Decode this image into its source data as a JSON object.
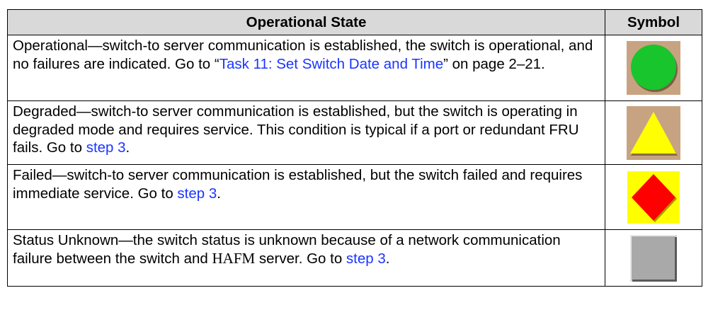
{
  "header": {
    "col_state": "Operational State",
    "col_symbol": "Symbol"
  },
  "rows": [
    {
      "text_before": "Operational—switch-to server communication is established, the switch is operational, and no failures are indicated. Go to “",
      "link": "Task 11: Set Switch Date and Time",
      "text_after": "” on page 2–21.",
      "symbol_icon": "green-circle-icon",
      "symbol_bg": "#c8a382",
      "symbol_color": "#18c52c"
    },
    {
      "text_before": "Degraded—switch-to server communication is established, but the switch is operating in degraded mode and requires service. This condition is typical if a port or redundant FRU fails. Go to ",
      "link": "step 3",
      "text_after": ".",
      "symbol_icon": "yellow-triangle-icon",
      "symbol_bg": "#c8a382",
      "symbol_color": "#ffff00"
    },
    {
      "text_before": "Failed—switch-to server communication is established, but the switch failed and requires immediate service. Go to ",
      "link": "step 3",
      "text_after": ".",
      "symbol_icon": "red-diamond-icon",
      "symbol_bg": "#ffff00",
      "symbol_color": "#ff0000"
    },
    {
      "text_before": "Status Unknown—the switch status is unknown because of a network communication failure between the switch and ",
      "text_serif": "HAFM",
      "text_mid": " server. Go to ",
      "link": "step 3",
      "text_after": ".",
      "symbol_icon": "gray-square-icon",
      "symbol_color": "#a9a9a9"
    }
  ]
}
